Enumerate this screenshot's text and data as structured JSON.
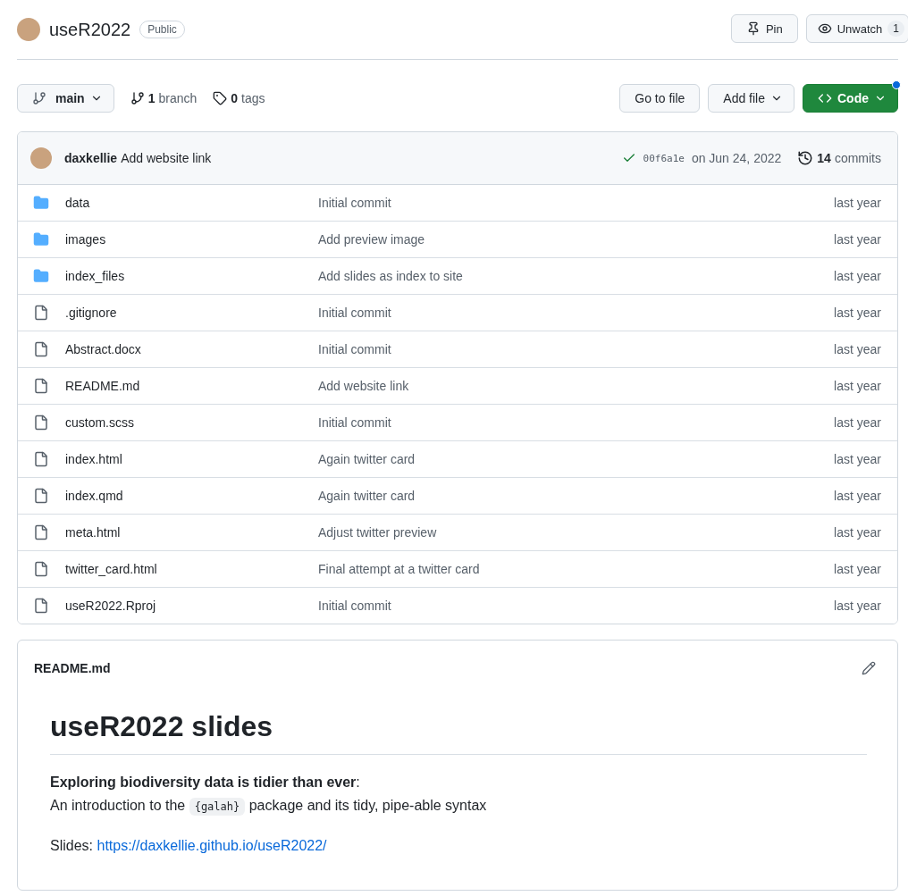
{
  "repo": {
    "name": "useR2022",
    "visibility": "Public",
    "pin": "Pin",
    "watch": "Unwatch",
    "watch_count": "1"
  },
  "toolbar": {
    "branch": "main",
    "branches_count": "1",
    "branches_label": "branch",
    "tags_count": "0",
    "tags_label": "tags",
    "go_to_file": "Go to file",
    "add_file": "Add file",
    "code": "Code",
    "code_notification": true
  },
  "latest_commit": {
    "author": "daxkellie",
    "message": "Add website link",
    "sha": "00f6a1e",
    "date": "on Jun 24, 2022",
    "commits_count": "14",
    "commits_label": "commits"
  },
  "files": [
    {
      "kind": "folder",
      "name": "data",
      "message": "Initial commit",
      "age": "last year"
    },
    {
      "kind": "folder",
      "name": "images",
      "message": "Add preview image",
      "age": "last year"
    },
    {
      "kind": "folder",
      "name": "index_files",
      "message": "Add slides as index to site",
      "age": "last year"
    },
    {
      "kind": "file",
      "name": ".gitignore",
      "message": "Initial commit",
      "age": "last year"
    },
    {
      "kind": "file",
      "name": "Abstract.docx",
      "message": "Initial commit",
      "age": "last year"
    },
    {
      "kind": "file",
      "name": "README.md",
      "message": "Add website link",
      "age": "last year"
    },
    {
      "kind": "file",
      "name": "custom.scss",
      "message": "Initial commit",
      "age": "last year"
    },
    {
      "kind": "file",
      "name": "index.html",
      "message": "Again twitter card",
      "age": "last year"
    },
    {
      "kind": "file",
      "name": "index.qmd",
      "message": "Again twitter card",
      "age": "last year"
    },
    {
      "kind": "file",
      "name": "meta.html",
      "message": "Adjust twitter preview",
      "age": "last year"
    },
    {
      "kind": "file",
      "name": "twitter_card.html",
      "message": "Final attempt at a twitter card",
      "age": "last year"
    },
    {
      "kind": "file",
      "name": "useR2022.Rproj",
      "message": "Initial commit",
      "age": "last year"
    }
  ],
  "readme": {
    "filename": "README.md",
    "heading": "useR2022 slides",
    "intro": "**Exploring biodiversity data is tidier than ever**:",
    "line_before": "An introduction to the",
    "code": "{galah}",
    "line_after": "package and its tidy, pipe-able syntax",
    "slides_label": "Slides:",
    "slides_link": "https://daxkellie.github.io/useR2022/"
  }
}
